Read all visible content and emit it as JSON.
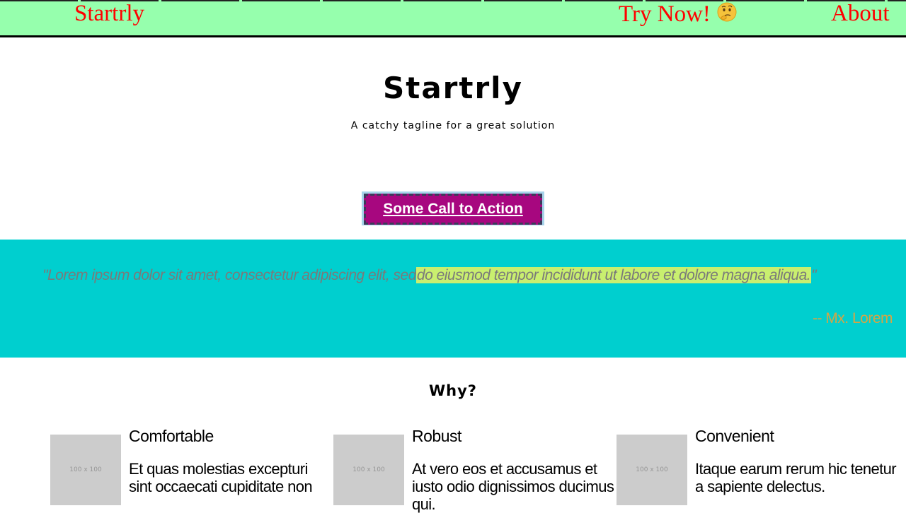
{
  "nav": {
    "brand": "Startrly",
    "try_now": "Try Now!",
    "try_icon": "thinking-face-icon",
    "about": "About"
  },
  "hero": {
    "title": "Startrly",
    "tagline": "A catchy tagline for a great solution",
    "cta": "Some Call to Action"
  },
  "quote": {
    "open": "\"",
    "text_plain": "Lorem ipsum dolor sit amet, consectetur adipiscing elit, sed",
    "text_highlight": "do eiusmod tempor incididunt ut labore et dolore magna aliqua.",
    "close": "\"",
    "author": "-- Mx. Lorem"
  },
  "why": {
    "title": "Why?",
    "features": [
      {
        "thumb_label": "100 x 100",
        "heading": "Comfortable",
        "body": "Et quas molestias excepturi sint occaecati cupiditate non"
      },
      {
        "thumb_label": "100 x 100",
        "heading": "Robust",
        "body": "At vero eos et accusamus et iusto odio dignissimos ducimus qui."
      },
      {
        "thumb_label": "100 x 100",
        "heading": "Convenient",
        "body": "Itaque earum rerum hic tenetur a sapiente delectus."
      }
    ]
  },
  "colors": {
    "nav_bg": "#96ffad",
    "nav_link": "#ff0000",
    "cta_bg": "#a7077f",
    "quote_bg": "#00cfcf",
    "quote_highlight": "#c9ef6f",
    "quote_author": "#d4a545"
  }
}
